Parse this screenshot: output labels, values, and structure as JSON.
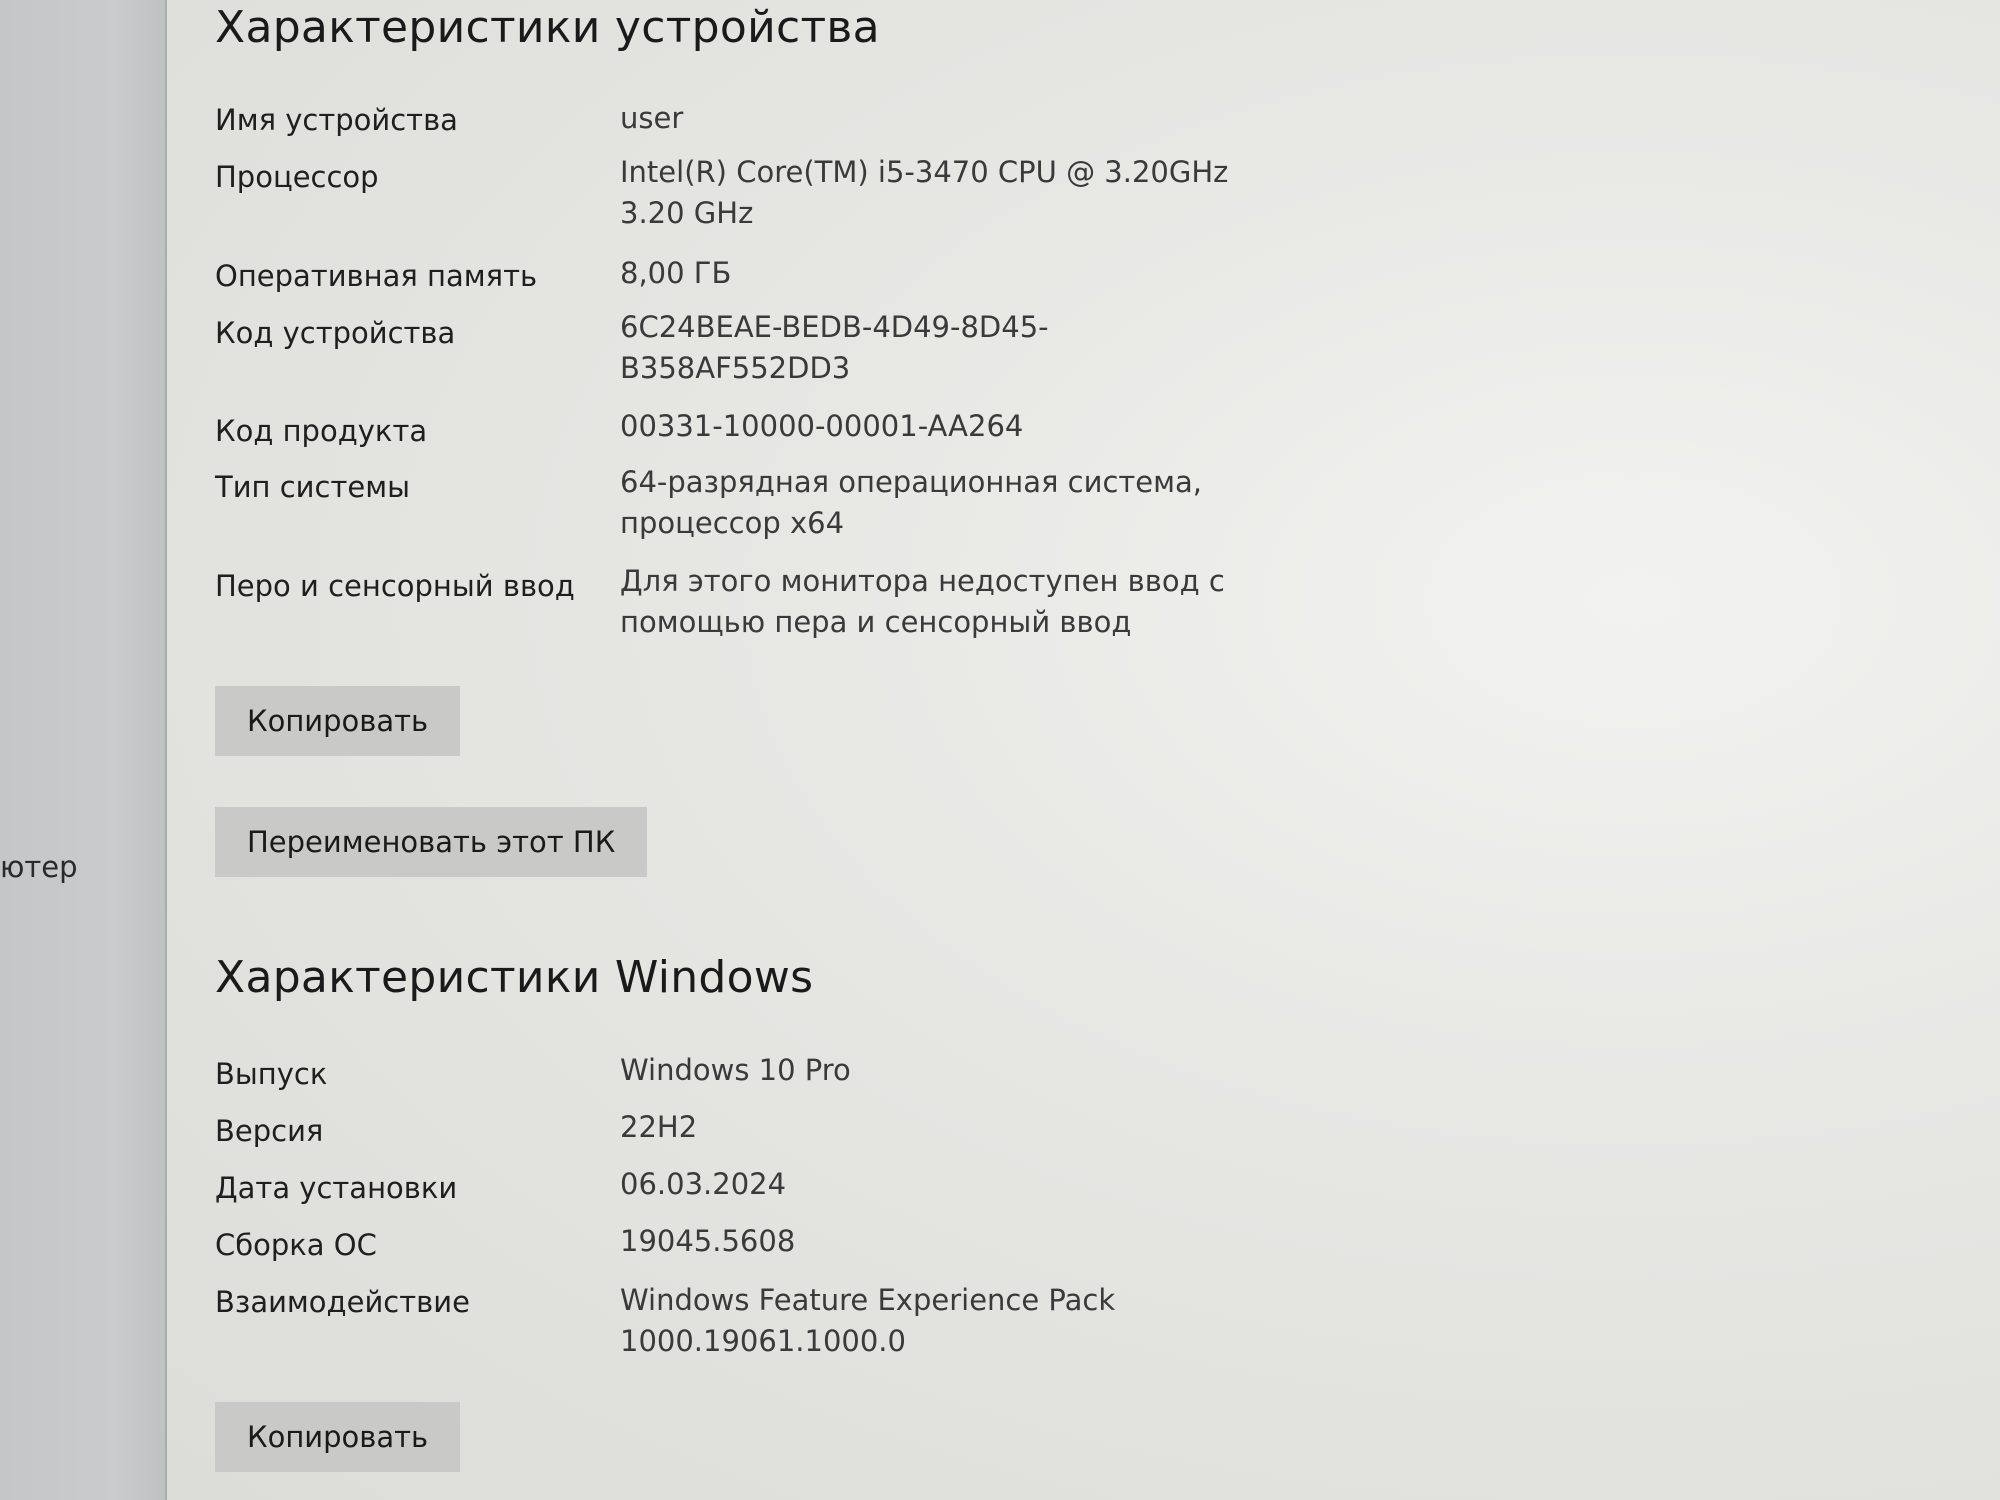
{
  "sidebar": {
    "partial_label": "ютер"
  },
  "device_specs": {
    "title": "Характеристики устройства",
    "rows": [
      {
        "label": "Имя устройства",
        "value_lines": [
          "user"
        ]
      },
      {
        "label": "Процессор",
        "value_lines": [
          "Intel(R) Core(TM) i5-3470 CPU @ 3.20GHz",
          "3.20 GHz"
        ]
      },
      {
        "label": "Оперативная память",
        "value_lines": [
          "8,00 ГБ"
        ]
      },
      {
        "label": "Код устройства",
        "value_lines": [
          "6C24BEAE-BEDB-4D49-8D45-",
          "B358AF552DD3"
        ]
      },
      {
        "label": "Код продукта",
        "value_lines": [
          "00331-10000-00001-AA264"
        ]
      },
      {
        "label": "Тип системы",
        "value_lines": [
          "64-разрядная операционная система,",
          "процессор x64"
        ]
      },
      {
        "label": "Перо и сенсорный ввод",
        "value_lines": [
          "Для этого монитора недоступен ввод с",
          "помощью пера и сенсорный ввод"
        ]
      }
    ],
    "copy_label": "Копировать",
    "rename_label": "Переименовать этот ПК"
  },
  "windows_specs": {
    "title": "Характеристики Windows",
    "rows": [
      {
        "label": "Выпуск",
        "value_lines": [
          "Windows 10 Pro"
        ]
      },
      {
        "label": "Версия",
        "value_lines": [
          "22H2"
        ]
      },
      {
        "label": "Дата установки",
        "value_lines": [
          "06.03.2024"
        ]
      },
      {
        "label": "Сборка ОС",
        "value_lines": [
          "19045.5608"
        ]
      },
      {
        "label": "Взаимодействие",
        "value_lines": [
          "Windows Feature Experience Pack",
          "1000.19061.1000.0"
        ]
      }
    ],
    "copy_label": "Копировать"
  }
}
